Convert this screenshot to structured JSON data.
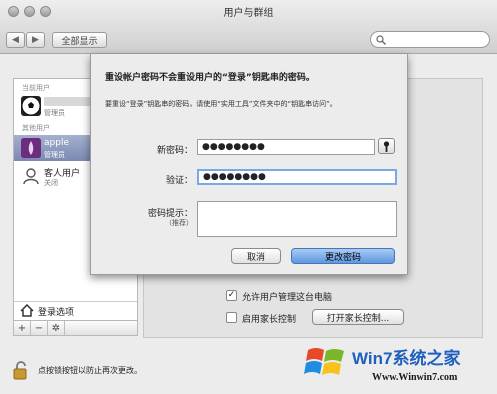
{
  "window": {
    "title": "用户与群组"
  },
  "toolbar": {
    "show_all": "全部显示"
  },
  "sidebar": {
    "current_user_section": "当前用户",
    "current_user_role": "管理员",
    "other_users_section": "其他用户",
    "users": [
      {
        "name": "apple",
        "role": "管理员"
      },
      {
        "name": "客人用户",
        "role": "关闭"
      }
    ],
    "login_options": "登录选项",
    "add": "+",
    "remove": "−",
    "gear": "✲"
  },
  "main": {
    "allow_admin": "允许用户管理这台电脑",
    "parental": "启用家长控制",
    "open_parental": "打开家长控制..."
  },
  "lock": {
    "text": "点按锁按钮以防止再次更改。"
  },
  "sheet": {
    "title": "重设帐户密码不会重设用户的“登录”钥匙串的密码。",
    "desc": "要重设“登录”钥匙串的密码，请使用“实用工具”文件夹中的“钥匙串访问”。",
    "new_password_label": "新密码：",
    "new_password_value": "●●●●●●●●",
    "verify_label": "验证：",
    "verify_value": "●●●●●●●●",
    "hint_label": "密码提示：",
    "hint_sub": "（推荐）",
    "cancel": "取消",
    "change": "更改密码"
  },
  "watermark": {
    "brand": "Win7系统之家",
    "url": "Www.Winwin7.com"
  },
  "colors": {
    "selection": "#8390b8",
    "primary_button": "#5e97e2",
    "watermark_orange": "#f08a1c"
  }
}
